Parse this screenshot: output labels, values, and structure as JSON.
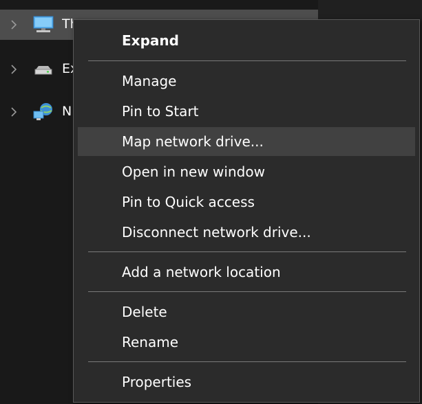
{
  "nav_pane": {
    "items": [
      {
        "label": "This PC",
        "icon": "computer-icon",
        "selected": true
      },
      {
        "label": "Ex",
        "icon": "drive-icon",
        "selected": false
      },
      {
        "label": "N",
        "icon": "network-icon",
        "selected": false
      }
    ]
  },
  "context_menu": {
    "items": [
      {
        "label": "Expand",
        "bold": true
      },
      {
        "label": "Manage"
      },
      {
        "label": "Pin to Start"
      },
      {
        "label": "Map network drive...",
        "hover": true
      },
      {
        "label": "Open in new window"
      },
      {
        "label": "Pin to Quick access"
      },
      {
        "label": "Disconnect network drive..."
      },
      {
        "label": "Add a network location"
      },
      {
        "label": "Delete"
      },
      {
        "label": "Rename"
      },
      {
        "label": "Properties"
      }
    ]
  },
  "colors": {
    "background": "#191919",
    "menu_background": "#2b2b2b",
    "menu_hover": "#414141",
    "selected_row": "#4d4d4d",
    "text": "#ffffff"
  }
}
